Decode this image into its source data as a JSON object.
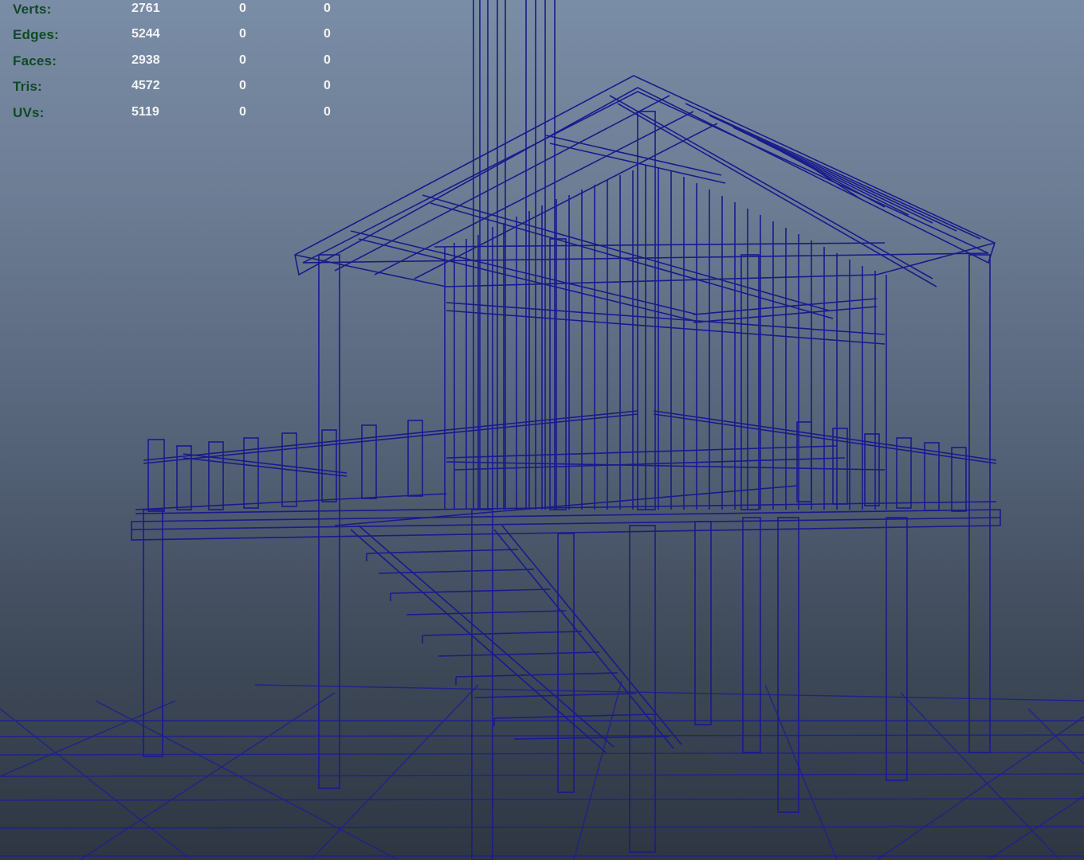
{
  "heads_up_display": {
    "poly_count": [
      {
        "label": "Verts:",
        "total": "2761",
        "selected": "0",
        "selected_components": "0"
      },
      {
        "label": "Edges:",
        "total": "5244",
        "selected": "0",
        "selected_components": "0"
      },
      {
        "label": "Faces:",
        "total": "2938",
        "selected": "0",
        "selected_components": "0"
      },
      {
        "label": "Tris:",
        "total": "4572",
        "selected": "0",
        "selected_components": "0"
      },
      {
        "label": "UVs:",
        "total": "5119",
        "selected": "0",
        "selected_components": "0"
      }
    ]
  },
  "viewport": {
    "display_mode": "wireframe",
    "wire_color": "#1a1a8c",
    "grid_color": "#1f1f8f",
    "label_color": "#0f4a24",
    "value_color": "#f2f4f6"
  }
}
